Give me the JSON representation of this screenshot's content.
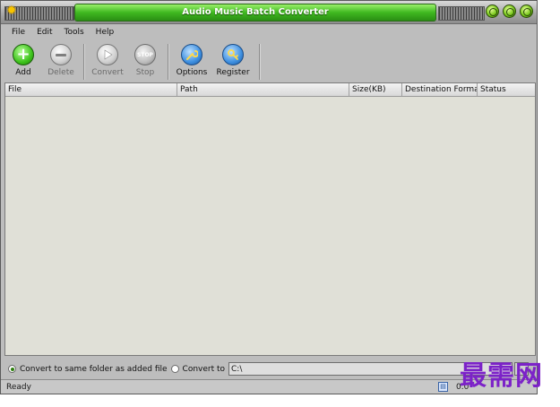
{
  "window": {
    "title": "Audio Music Batch Converter"
  },
  "menu": [
    "File",
    "Edit",
    "Tools",
    "Help"
  ],
  "toolbar": {
    "add": "Add",
    "delete": "Delete",
    "convert": "Convert",
    "stop": "Stop",
    "stop_icon_text": "STOP",
    "options": "Options",
    "register": "Register"
  },
  "table": {
    "columns": [
      "File",
      "Path",
      "Size(KB)",
      "Destination Format",
      "Status"
    ],
    "rows": []
  },
  "output": {
    "same_folder_label": "Convert to same folder as added file",
    "convert_to_label": "Convert to",
    "path_value": "C:\\",
    "selected": "same_folder"
  },
  "status": {
    "text": "Ready",
    "size": "0.0"
  },
  "watermark": "最需网",
  "colors": {
    "title_green": "#3fb820",
    "list_bg": "#e0e0d7",
    "watermark": "#7c22c8"
  }
}
